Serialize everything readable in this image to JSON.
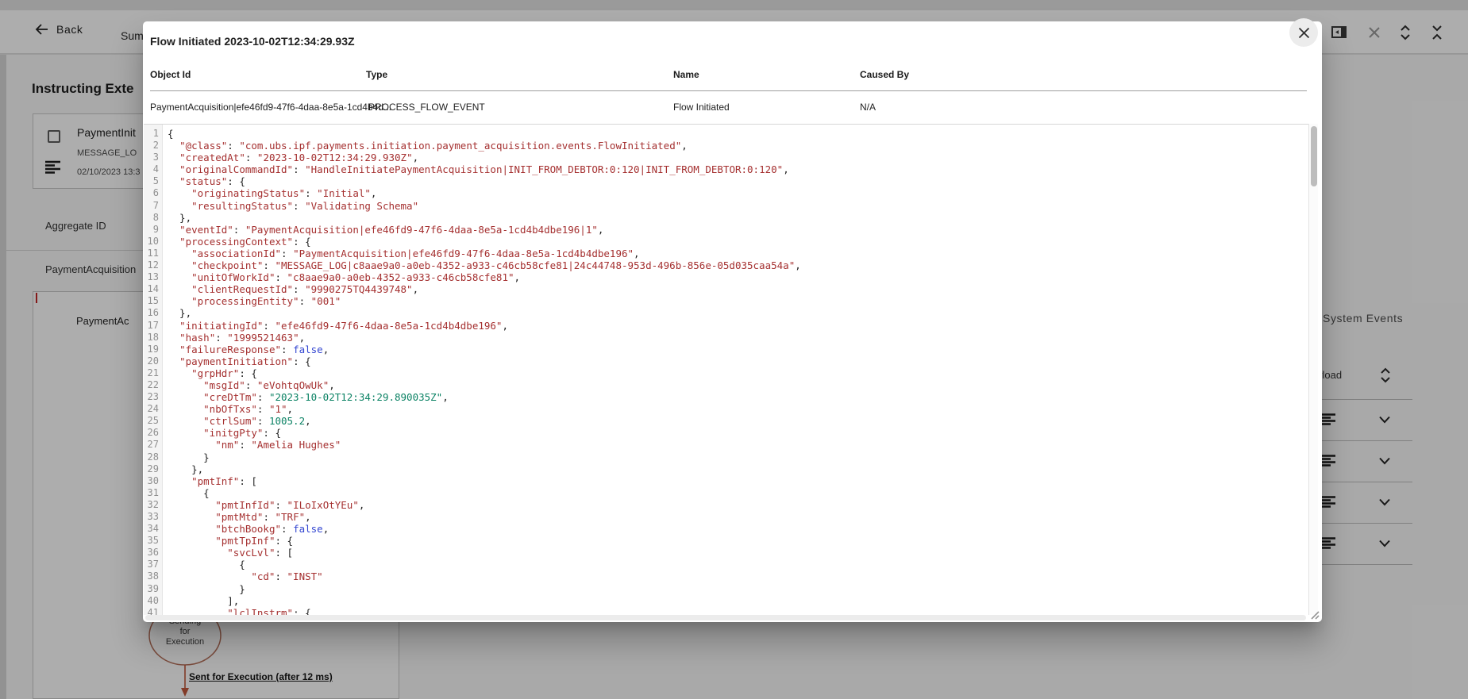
{
  "colors": {
    "string": "#a53030",
    "number": "#0b8264",
    "boolean": "#3346d1",
    "flow_accent": "#bf5b40"
  },
  "page": {
    "top_nav": {
      "back": "Back",
      "tab": "Sum"
    },
    "heading": "Instructing Exte",
    "message_card": {
      "title": "PaymentInit",
      "type": "MESSAGE_LO",
      "timestamp": "02/10/2023 13:3"
    },
    "aggregate": {
      "label": "Aggregate ID",
      "value": "PaymentAcquisition"
    },
    "detail_card": {
      "title": "PaymentAc"
    },
    "flow": {
      "node_line1": "Sending",
      "node_line2": "for",
      "node_line3": "Execution",
      "edge_label": "Sent for Execution (after 12 ms)"
    },
    "system_events": {
      "title": "System Events",
      "column": "yload"
    }
  },
  "modal": {
    "title": "Flow Initiated 2023-10-02T12:34:29.93Z",
    "columns": [
      "Object Id",
      "Type",
      "Name",
      "Caused By"
    ],
    "row": {
      "object_id": "PaymentAcquisition|efe46fd9-47f6-4daa-8e5a-1cd4b4d...",
      "type": "PROCESS_FLOW_EVENT",
      "name": "Flow Initiated",
      "caused_by": "N/A"
    },
    "code_lines": [
      "{",
      "  \"@class\": \"com.ubs.ipf.payments.initiation.payment_acquisition.events.FlowInitiated\",",
      "  \"createdAt\": \"2023-10-02T12:34:29.930Z\",",
      "  \"originalCommandId\": \"HandleInitiatePaymentAcquisition|INIT_FROM_DEBTOR:0:120|INIT_FROM_DEBTOR:0:120\",",
      "  \"status\": {",
      "    \"originatingStatus\": \"Initial\",",
      "    \"resultingStatus\": \"Validating Schema\"",
      "  },",
      "  \"eventId\": \"PaymentAcquisition|efe46fd9-47f6-4daa-8e5a-1cd4b4dbe196|1\",",
      "  \"processingContext\": {",
      "    \"associationId\": \"PaymentAcquisition|efe46fd9-47f6-4daa-8e5a-1cd4b4dbe196\",",
      "    \"checkpoint\": \"MESSAGE_LOG|c8aae9a0-a0eb-4352-a933-c46cb58cfe81|24c44748-953d-496b-856e-05d035caa54a\",",
      "    \"unitOfWorkId\": \"c8aae9a0-a0eb-4352-a933-c46cb58cfe81\",",
      "    \"clientRequestId\": \"9990275TQ4439748\",",
      "    \"processingEntity\": \"001\"",
      "  },",
      "  \"initiatingId\": \"efe46fd9-47f6-4daa-8e5a-1cd4b4dbe196\",",
      "  \"hash\": \"1999521463\",",
      "  \"failureResponse\": false,",
      "  \"paymentInitiation\": {",
      "    \"grpHdr\": {",
      "      \"msgId\": \"eVohtqOwUk\",",
      "      \"creDtTm\": \"2023-10-02T12:34:29.890035Z\",",
      "      \"nbOfTxs\": \"1\",",
      "      \"ctrlSum\": 1005.2,",
      "      \"initgPty\": {",
      "        \"nm\": \"Amelia Hughes\"",
      "      }",
      "    },",
      "    \"pmtInf\": [",
      "      {",
      "        \"pmtInfId\": \"ILoIxOtYEu\",",
      "        \"pmtMtd\": \"TRF\",",
      "        \"btchBookg\": false,",
      "        \"pmtTpInf\": {",
      "          \"svcLvl\": [",
      "            {",
      "              \"cd\": \"INST\"",
      "            }",
      "          ],",
      "          \"lclInstrm\": {"
    ]
  }
}
